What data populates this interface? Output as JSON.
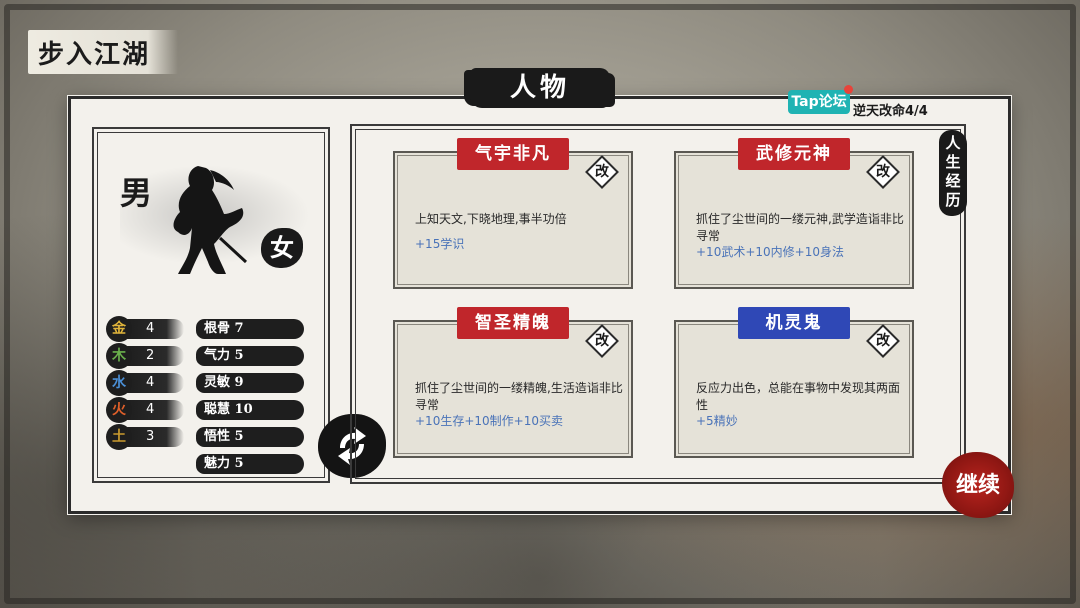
{
  "header": {
    "title": "步入江湖",
    "panel_title": "人物"
  },
  "tap_badge": {
    "label": "Tap论坛"
  },
  "counter": {
    "label": "逆天改命4/4"
  },
  "gender": {
    "male": "男",
    "female": "女"
  },
  "elements": [
    {
      "symbol": "金",
      "value": "4",
      "color": "#e0b43a",
      "attr": "根骨 7"
    },
    {
      "symbol": "木",
      "value": "2",
      "color": "#6ab04c",
      "attr": "气力 5"
    },
    {
      "symbol": "水",
      "value": "4",
      "color": "#4a8fd6",
      "attr": "灵敏 9"
    },
    {
      "symbol": "火",
      "value": "4",
      "color": "#e0602a",
      "attr": "聪慧 10"
    },
    {
      "symbol": "土",
      "value": "3",
      "color": "#c99a2e",
      "attr": "悟性 5"
    },
    {
      "symbol": "",
      "value": "",
      "color": "",
      "attr": "魅力 5"
    }
  ],
  "traits": [
    {
      "title": "气宇非凡",
      "title_color": "#c0262b",
      "edit": "改",
      "desc": "上知天文,下晓地理,事半功倍",
      "bonus": "+15学识"
    },
    {
      "title": "武修元神",
      "title_color": "#c0262b",
      "edit": "改",
      "desc": "抓住了尘世间的一缕元神,武学造诣非比寻常",
      "bonus": "+10武术+10内修+10身法"
    },
    {
      "title": "智圣精魄",
      "title_color": "#c0262b",
      "edit": "改",
      "desc": "抓住了尘世间的一缕精魄,生活造诣非比寻常",
      "bonus": "+10生存+10制作+10买卖"
    },
    {
      "title": "机灵鬼",
      "title_color": "#2f48b6",
      "edit": "改",
      "desc": "反应力出色，总能在事物中发现其两面性",
      "bonus": "+5精妙"
    }
  ],
  "side_tab": {
    "label": "人生经历"
  },
  "continue": {
    "label": "继续"
  }
}
